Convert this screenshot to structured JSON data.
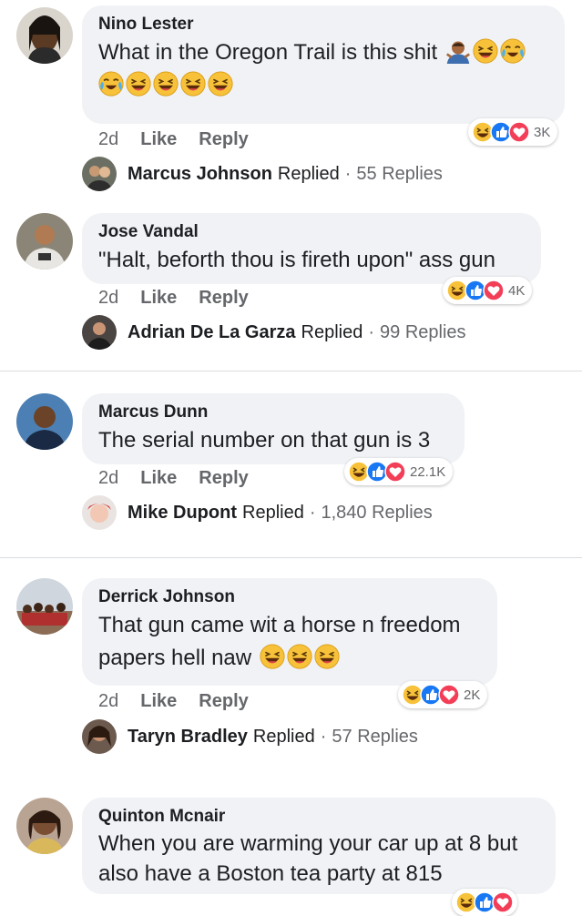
{
  "comments": [
    {
      "author": "Nino Lester",
      "text_line1": "What in the Oregon Trail is this shit",
      "time": "2d",
      "like": "Like",
      "reply": "Reply",
      "reaction_count": "3K",
      "reply_author": "Marcus Johnson",
      "replied_word": "Replied",
      "reply_count": "55 Replies"
    },
    {
      "author": "Jose Vandal",
      "text_line1": "\"Halt, beforth thou is fireth upon\" ass gun",
      "time": "2d",
      "like": "Like",
      "reply": "Reply",
      "reaction_count": "4K",
      "reply_author": "Adrian De La Garza",
      "replied_word": "Replied",
      "reply_count": "99 Replies"
    },
    {
      "author": "Marcus Dunn",
      "text_line1": "The serial number on that gun is 3",
      "time": "2d",
      "like": "Like",
      "reply": "Reply",
      "reaction_count": "22.1K",
      "reply_author": "Mike Dupont",
      "replied_word": "Replied",
      "reply_count": "1,840 Replies"
    },
    {
      "author": "Derrick Johnson",
      "text_line1": "That gun came wit a horse n freedom",
      "text_line2": "papers hell naw",
      "time": "2d",
      "like": "Like",
      "reply": "Reply",
      "reaction_count": "2K",
      "reply_author": "Taryn Bradley",
      "replied_word": "Replied",
      "reply_count": "57 Replies"
    },
    {
      "author": "Quinton Mcnair",
      "text_line1": "When you are warming your car up at 8 but",
      "text_line2": "also have a Boston tea party at 815"
    }
  ],
  "reply_separator": "·",
  "colors": {
    "bubble": "#f0f2f5",
    "like_blue": "#1877f2",
    "love_red": "#f33e58",
    "haha_yellow": "#f7b125",
    "meta_gray": "#65676b"
  },
  "icons": {
    "haha": "laughing-emoji",
    "cry_laugh": "tears-of-joy-emoji",
    "shrug": "person-shrugging-emoji",
    "like": "thumbs-up-reaction",
    "love": "heart-reaction"
  }
}
